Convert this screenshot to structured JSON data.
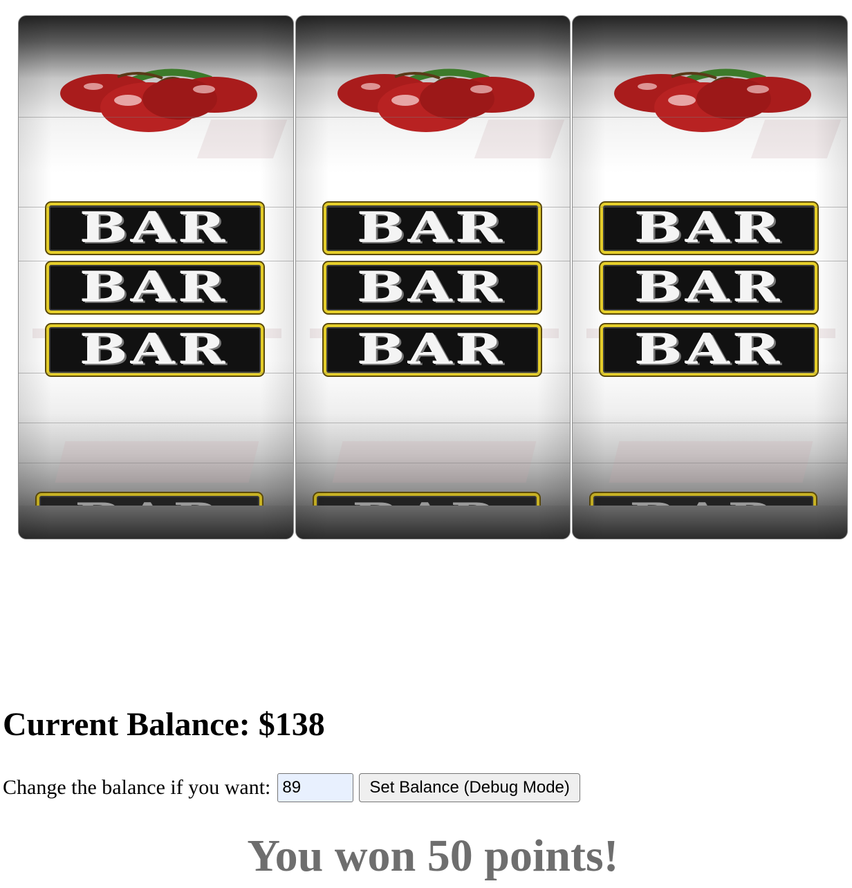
{
  "reels": [
    {
      "symbols": [
        "cherries",
        "bar",
        "bar",
        "bar",
        "bar"
      ]
    },
    {
      "symbols": [
        "cherries",
        "bar",
        "bar",
        "bar",
        "bar"
      ]
    },
    {
      "symbols": [
        "cherries",
        "bar",
        "bar",
        "bar",
        "bar"
      ]
    }
  ],
  "symbol_text": {
    "bar": "BAR"
  },
  "balance": {
    "heading": "Current Balance: $138"
  },
  "controls": {
    "prompt": "Change the balance if you want:",
    "input_value": "89",
    "set_button_label": "Set Balance (Debug Mode)"
  },
  "result": {
    "message": "You won 50 points!"
  },
  "colors": {
    "bar_border": "#e6cf2a",
    "cherry": "#b3201f",
    "message_gray": "#6e6e6e",
    "input_bg": "#e8f0fe"
  }
}
